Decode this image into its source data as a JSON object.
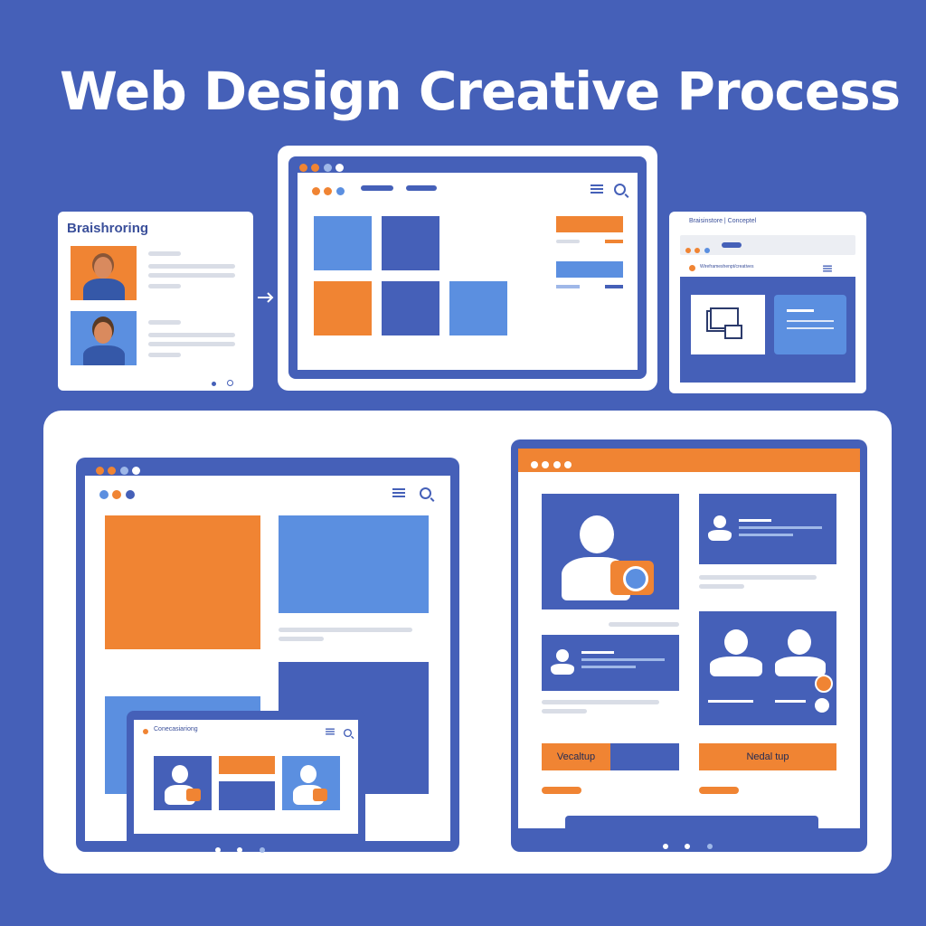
{
  "title": "Web Design Creative Process",
  "brainstorm": {
    "heading": "Braishroring"
  },
  "mobile_card": {
    "heading": "Braisinstore | Conceptel",
    "subline": "Wireframeshenpt/creatives"
  },
  "embedded_window": {
    "heading": "Conecasiariong"
  },
  "right_panel": {
    "button_left": "Vecaltup",
    "button_right": "Nedal tup"
  },
  "colors": {
    "background": "#4560b8",
    "orange": "#f08433",
    "light_blue": "#5b8fe0",
    "white": "#ffffff"
  }
}
